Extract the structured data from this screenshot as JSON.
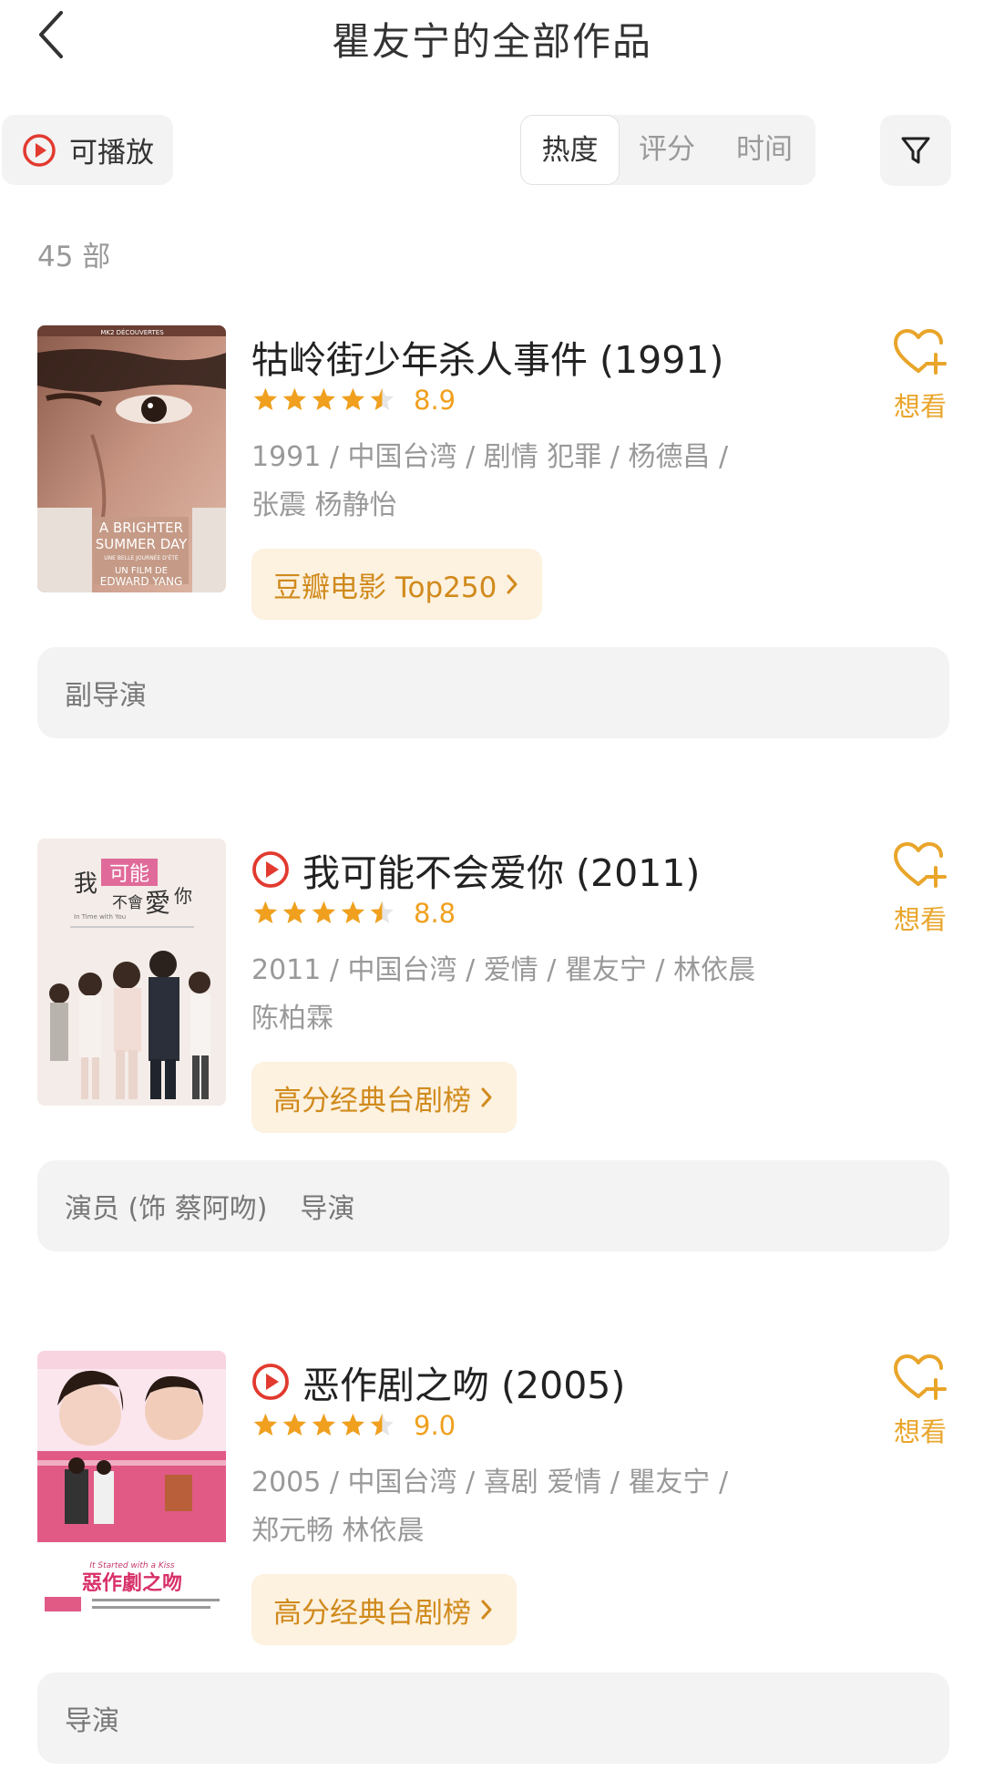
{
  "header": {
    "title": "瞿友宁的全部作品"
  },
  "filters": {
    "playable_label": "可播放",
    "sort_options": [
      "热度",
      "评分",
      "时间"
    ],
    "active_sort": "热度"
  },
  "count_label": "45 部",
  "colors": {
    "accent": "#f0a01e",
    "play_red": "#e23a2f",
    "badge_bg": "#fdf1df",
    "badge_text": "#d08a1c"
  },
  "works": [
    {
      "title": "牯岭街少年杀人事件 (1991)",
      "playable": false,
      "rating": 4.5,
      "score": "8.9",
      "meta_line1": "1991 / 中国台湾 / 剧情 犯罪 / 杨德昌 /",
      "meta_line2": "张震 杨静怡",
      "badge": "豆瓣电影 Top250",
      "want_label": "想看",
      "roles": [
        "副导演"
      ],
      "poster": {
        "top_text": "MK2 DÉCOUVERTES",
        "lines": [
          "A BRIGHTER",
          "SUMMER DAY"
        ],
        "sub": "UNE BELLE JOURNÉE D'ÉTÉ",
        "credit1": "UN FILM DE",
        "credit2": "EDWARD YANG"
      }
    },
    {
      "title": "我可能不会爱你 (2011)",
      "playable": true,
      "rating": 4.5,
      "score": "8.8",
      "meta_line1": "2011 / 中国台湾 / 爱情 / 瞿友宁 / 林依晨",
      "meta_line2": "陈柏霖",
      "badge": "高分经典台剧榜",
      "want_label": "想看",
      "roles": [
        "演员 (饰 蔡阿吻)",
        "导演"
      ],
      "poster": {
        "t1": "我",
        "t2": "可能",
        "t3": "不會",
        "t4": "愛",
        "t5": "你",
        "en": "In Time with You"
      }
    },
    {
      "title": "恶作剧之吻 (2005)",
      "playable": true,
      "rating": 4.5,
      "score": "9.0",
      "meta_line1": "2005 / 中国台湾 / 喜剧 爱情 / 瞿友宁 /",
      "meta_line2": "郑元畅 林依晨",
      "badge": "高分经典台剧榜",
      "want_label": "想看",
      "roles": [
        "导演"
      ],
      "poster": {
        "logo": "惡作劇之吻",
        "en": "It Started with a Kiss"
      }
    }
  ]
}
